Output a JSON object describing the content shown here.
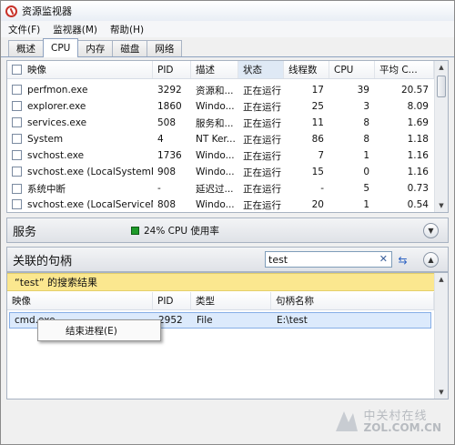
{
  "window": {
    "title": "资源监视器"
  },
  "menu": [
    "文件(F)",
    "监视器(M)",
    "帮助(H)"
  ],
  "tabs": [
    {
      "label": "概述",
      "active": false
    },
    {
      "label": "CPU",
      "active": true
    },
    {
      "label": "内存",
      "active": false
    },
    {
      "label": "磁盘",
      "active": false
    },
    {
      "label": "网络",
      "active": false
    }
  ],
  "process_table": {
    "columns": [
      "映像",
      "PID",
      "描述",
      "状态",
      "线程数",
      "CPU",
      "平均 C..."
    ],
    "rows": [
      {
        "image": "perfmon.exe",
        "pid": "3292",
        "desc": "资源和...",
        "status": "正在运行",
        "threads": "17",
        "cpu": "39",
        "avg": "20.57"
      },
      {
        "image": "explorer.exe",
        "pid": "1860",
        "desc": "Windo...",
        "status": "正在运行",
        "threads": "25",
        "cpu": "3",
        "avg": "8.09"
      },
      {
        "image": "services.exe",
        "pid": "508",
        "desc": "服务和...",
        "status": "正在运行",
        "threads": "11",
        "cpu": "8",
        "avg": "1.69"
      },
      {
        "image": "System",
        "pid": "4",
        "desc": "NT Ker...",
        "status": "正在运行",
        "threads": "86",
        "cpu": "8",
        "avg": "1.18"
      },
      {
        "image": "svchost.exe",
        "pid": "1736",
        "desc": "Windo...",
        "status": "正在运行",
        "threads": "7",
        "cpu": "1",
        "avg": "1.16"
      },
      {
        "image": "svchost.exe (LocalSystemN...",
        "pid": "908",
        "desc": "Windo...",
        "status": "正在运行",
        "threads": "15",
        "cpu": "0",
        "avg": "1.16"
      },
      {
        "image": "系统中断",
        "pid": "-",
        "desc": "延迟过...",
        "status": "正在运行",
        "threads": "-",
        "cpu": "5",
        "avg": "0.73"
      },
      {
        "image": "svchost.exe (LocalServiceN...",
        "pid": "808",
        "desc": "Windo...",
        "status": "正在运行",
        "threads": "20",
        "cpu": "1",
        "avg": "0.54"
      }
    ]
  },
  "services": {
    "title": "服务",
    "cpu_usage": "24% CPU 使用率"
  },
  "handles": {
    "title": "关联的句柄",
    "search_value": "test",
    "result_banner": "“test” 的搜索结果",
    "columns": [
      "映像",
      "PID",
      "类型",
      "句柄名称"
    ],
    "rows": [
      {
        "image": "cmd.exe",
        "pid": "2952",
        "type": "File",
        "name": "E:\\test"
      }
    ]
  },
  "context_menu": {
    "items": [
      "结束进程(E)"
    ]
  },
  "watermark": {
    "top": "中关村在线",
    "bottom": "ZOL.COM.CN"
  },
  "icons": [
    "app-icon",
    "checkbox-icon",
    "collapse-icon",
    "clear-icon",
    "refresh-icon",
    "scroll-up-icon",
    "scroll-down-icon"
  ],
  "colors": {
    "cpu_meter": "#1e9a2a",
    "result_banner": "#fbe78f",
    "selection": "#dceafc"
  }
}
